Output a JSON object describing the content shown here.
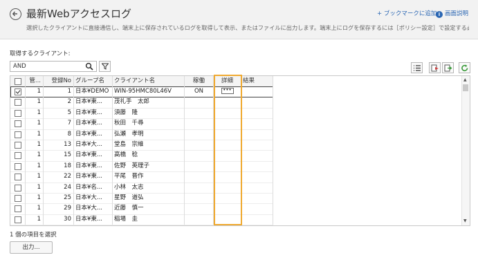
{
  "header": {
    "title": "最新Webアクセスログ",
    "subtitle": "選択したクライアントに直接通信し、端末上に保存されているログを取得して表示、またはファイルに出力します。端末上にログを保存するには［ポリシー設定］で設定する必要があ...",
    "bookmark_link": "+ ブックマークに追加",
    "help_link": "画面説明",
    "colors": {
      "link": "#2a66b3",
      "highlight": "#f0a92f"
    }
  },
  "filter": {
    "label": "取得するクライアント:",
    "search_value": "AND"
  },
  "grid": {
    "headers": [
      "",
      "管...",
      "登録No",
      "グループ名",
      "クライアント名",
      "稼働",
      "詳細",
      "結果"
    ],
    "rows": [
      {
        "checked": true,
        "kan": "1",
        "no": "1",
        "group": "日本¥DEMO",
        "client": "WIN-95HMC80L46V",
        "run": "ON",
        "detail": "•••",
        "result": ""
      },
      {
        "checked": false,
        "kan": "1",
        "no": "2",
        "group": "日本¥東...",
        "client": "茂礼手　太郎",
        "run": "",
        "detail": "",
        "result": ""
      },
      {
        "checked": false,
        "kan": "1",
        "no": "5",
        "group": "日本¥東...",
        "client": "須藤　隆",
        "run": "",
        "detail": "",
        "result": ""
      },
      {
        "checked": false,
        "kan": "1",
        "no": "7",
        "group": "日本¥東...",
        "client": "秋田　千尋",
        "run": "",
        "detail": "",
        "result": ""
      },
      {
        "checked": false,
        "kan": "1",
        "no": "8",
        "group": "日本¥東...",
        "client": "弘瀬　孝明",
        "run": "",
        "detail": "",
        "result": ""
      },
      {
        "checked": false,
        "kan": "1",
        "no": "13",
        "group": "日本¥大...",
        "client": "堂島　宗維",
        "run": "",
        "detail": "",
        "result": ""
      },
      {
        "checked": false,
        "kan": "1",
        "no": "15",
        "group": "日本¥東...",
        "client": "高橋　稔",
        "run": "",
        "detail": "",
        "result": ""
      },
      {
        "checked": false,
        "kan": "1",
        "no": "18",
        "group": "日本¥東...",
        "client": "佐野　英理子",
        "run": "",
        "detail": "",
        "result": ""
      },
      {
        "checked": false,
        "kan": "1",
        "no": "22",
        "group": "日本¥東...",
        "client": "平尾　晋作",
        "run": "",
        "detail": "",
        "result": ""
      },
      {
        "checked": false,
        "kan": "1",
        "no": "24",
        "group": "日本¥名...",
        "client": "小林　太志",
        "run": "",
        "detail": "",
        "result": ""
      },
      {
        "checked": false,
        "kan": "1",
        "no": "25",
        "group": "日本¥大...",
        "client": "星野　道弘",
        "run": "",
        "detail": "",
        "result": ""
      },
      {
        "checked": false,
        "kan": "1",
        "no": "29",
        "group": "日本¥大...",
        "client": "近藤　慎一",
        "run": "",
        "detail": "",
        "result": ""
      },
      {
        "checked": false,
        "kan": "1",
        "no": "30",
        "group": "日本¥東...",
        "client": "稲場　圭",
        "run": "",
        "detail": "",
        "result": ""
      }
    ]
  },
  "status_text": "1 個の項目を選択",
  "output_button": "出力..."
}
